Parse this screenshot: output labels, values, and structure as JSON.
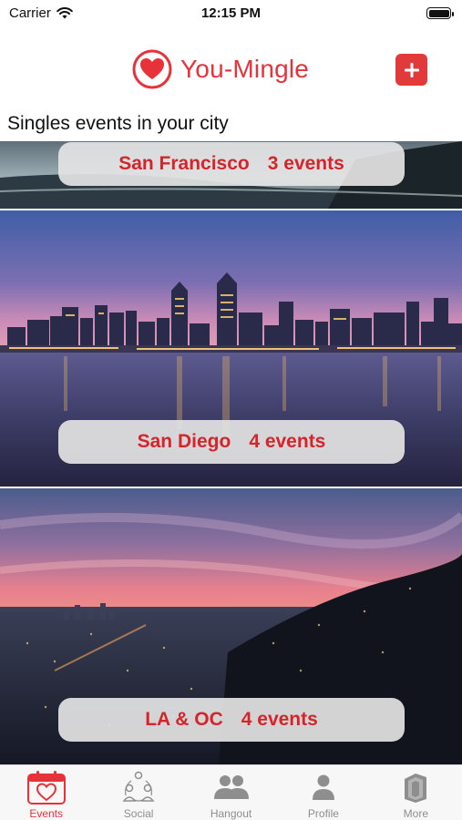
{
  "status_bar": {
    "carrier": "Carrier",
    "time": "12:15 PM"
  },
  "header": {
    "title": "You-Mingle",
    "add_icon": "plus-icon",
    "logo_icon": "heart-logo-icon",
    "accent_color": "#e8323a"
  },
  "section_title": "Singles events in your city",
  "cities": [
    {
      "name": "San Francisco",
      "events": "3 events"
    },
    {
      "name": "San Diego",
      "events": "4 events"
    },
    {
      "name": "LA & OC",
      "events": "4 events"
    }
  ],
  "tabs": [
    {
      "label": "Events",
      "icon": "calendar-heart-icon",
      "active": true
    },
    {
      "label": "Social",
      "icon": "people-network-icon",
      "active": false
    },
    {
      "label": "Hangout",
      "icon": "group-icon",
      "active": false
    },
    {
      "label": "Profile",
      "icon": "person-icon",
      "active": false
    },
    {
      "label": "More",
      "icon": "cards-icon",
      "active": false
    }
  ]
}
